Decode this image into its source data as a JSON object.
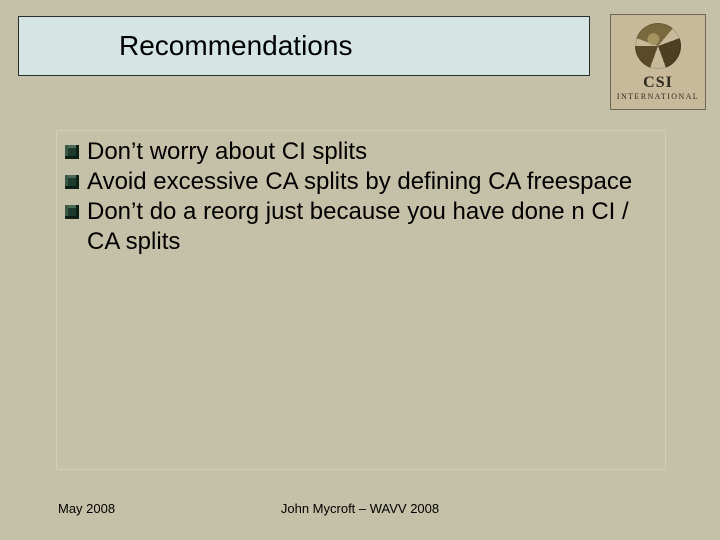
{
  "title": "Recommendations",
  "logo": {
    "line1": "CSI",
    "line2": "International"
  },
  "bullets": [
    "Don’t worry about CI splits",
    "Avoid excessive CA splits by defining CA freespace",
    "Don’t do a reorg just because you have done n CI / CA splits"
  ],
  "footer": {
    "date": "May 2008",
    "credit": "John Mycroft – WAVV 2008"
  }
}
